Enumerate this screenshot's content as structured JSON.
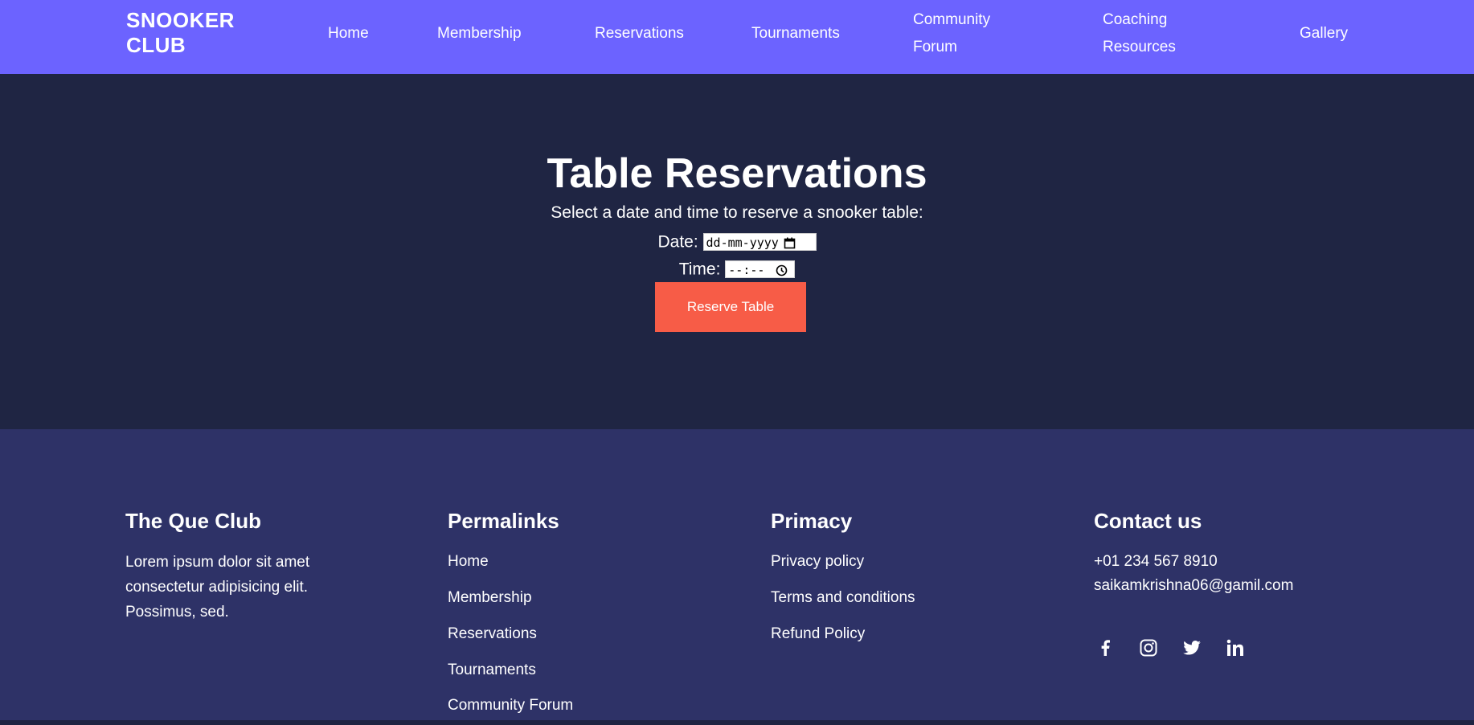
{
  "header": {
    "brand_line1": "SNOOKER",
    "brand_line2": "CLUB",
    "nav": [
      {
        "label": "Home"
      },
      {
        "label": "Membership"
      },
      {
        "label": "Reservations"
      },
      {
        "label": "Tournaments"
      },
      {
        "line1": "Community",
        "line2": "Forum"
      },
      {
        "line1": "Coaching",
        "line2": "Resources"
      },
      {
        "label": "Gallery"
      }
    ]
  },
  "hero": {
    "title": "Table Reservations",
    "subtitle": "Select a date and time to reserve a snooker table:",
    "date_label": "Date:",
    "date_placeholder": "dd-mm-yyyy",
    "time_label": "Time:",
    "time_placeholder": "--:--",
    "button_label": "Reserve Table"
  },
  "footer": {
    "about": {
      "heading": "The Que Club",
      "text": "Lorem ipsum dolor sit amet consectetur adipisicing elit. Possimus, sed."
    },
    "permalinks": {
      "heading": "Permalinks",
      "links": [
        "Home",
        "Membership",
        "Reservations",
        "Tournaments",
        "Community Forum"
      ]
    },
    "primacy": {
      "heading": "Primacy",
      "links": [
        "Privacy policy",
        "Terms and conditions",
        "Refund Policy"
      ]
    },
    "contact": {
      "heading": "Contact us",
      "phone": "+01 234 567 8910",
      "email": "saikamkrishna06@gamil.com",
      "social_icons": [
        "facebook-icon",
        "instagram-icon",
        "twitter-icon",
        "linkedin-icon"
      ]
    }
  },
  "colors": {
    "nav_bg": "#6c63ff",
    "hero_bg": "#1f2543",
    "footer_bg": "#2e3267",
    "button_bg": "#f75c47"
  }
}
